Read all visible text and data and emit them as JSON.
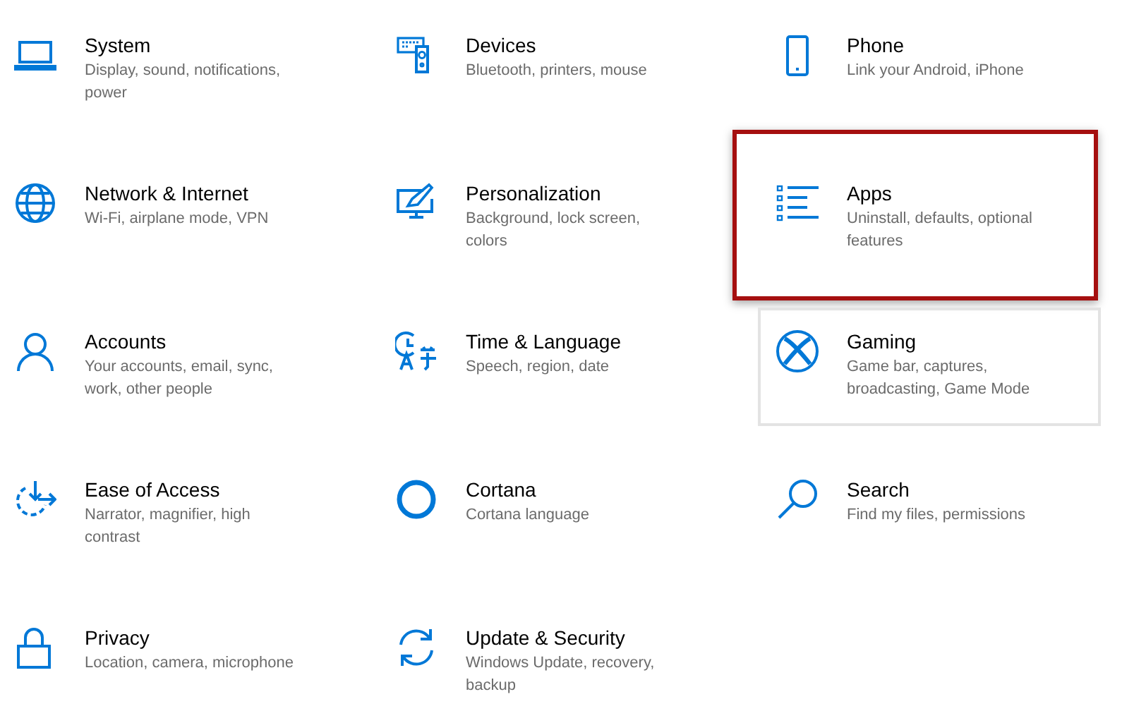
{
  "items": [
    {
      "title": "System",
      "description": "Display, sound, notifications, power",
      "hovered": false,
      "highlighted": false
    },
    {
      "title": "Devices",
      "description": "Bluetooth, printers, mouse",
      "hovered": false,
      "highlighted": false
    },
    {
      "title": "Phone",
      "description": "Link your Android, iPhone",
      "hovered": false,
      "highlighted": false
    },
    {
      "title": "Network & Internet",
      "description": "Wi-Fi, airplane mode, VPN",
      "hovered": false,
      "highlighted": false
    },
    {
      "title": "Personalization",
      "description": "Background, lock screen, colors",
      "hovered": false,
      "highlighted": false
    },
    {
      "title": "Apps",
      "description": "Uninstall, defaults, optional features",
      "hovered": false,
      "highlighted": true
    },
    {
      "title": "Accounts",
      "description": "Your accounts, email, sync, work, other people",
      "hovered": false,
      "highlighted": false
    },
    {
      "title": "Time & Language",
      "description": "Speech, region, date",
      "hovered": false,
      "highlighted": false
    },
    {
      "title": "Gaming",
      "description": "Game bar, captures, broadcasting, Game Mode",
      "hovered": true,
      "highlighted": false
    },
    {
      "title": "Ease of Access",
      "description": "Narrator, magnifier, high contrast",
      "hovered": false,
      "highlighted": false
    },
    {
      "title": "Cortana",
      "description": "Cortana language",
      "hovered": false,
      "highlighted": false
    },
    {
      "title": "Search",
      "description": "Find my files, permissions",
      "hovered": false,
      "highlighted": false
    },
    {
      "title": "Privacy",
      "description": "Location, camera, microphone",
      "hovered": false,
      "highlighted": false
    },
    {
      "title": "Update & Security",
      "description": "Windows Update, recovery, backup",
      "hovered": false,
      "highlighted": false
    }
  ]
}
